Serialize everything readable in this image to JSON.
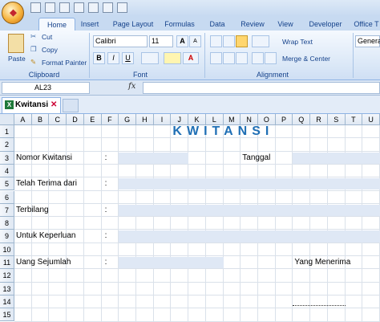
{
  "tabs": [
    "Home",
    "Insert",
    "Page Layout",
    "Formulas",
    "Data",
    "Review",
    "View",
    "Developer",
    "Office T"
  ],
  "clipboard": {
    "paste": "Paste",
    "cut": "Cut",
    "copy": "Copy",
    "format_painter": "Format Painter",
    "label": "Clipboard"
  },
  "font": {
    "name": "Calibri",
    "size": "11",
    "label": "Font",
    "bold": "B",
    "italic": "I",
    "underline": "U",
    "grow": "A",
    "shrink": "A",
    "color": "A"
  },
  "alignment": {
    "wrap_text": "Wrap Text",
    "merge_center": "Merge & Center",
    "label": "Alignment"
  },
  "number": {
    "format": "Genera"
  },
  "formula_bar": {
    "name_box": "AL23",
    "fx": "fx"
  },
  "workbook": {
    "tab_label": "Kwitansi",
    "close": "✕"
  },
  "columns": [
    "A",
    "B",
    "C",
    "D",
    "E",
    "F",
    "G",
    "H",
    "I",
    "J",
    "K",
    "L",
    "M",
    "N",
    "O",
    "P",
    "Q",
    "R",
    "S",
    "T",
    "U"
  ],
  "rows": [
    "1",
    "2",
    "3",
    "4",
    "5",
    "6",
    "7",
    "8",
    "9",
    "10",
    "11",
    "12",
    "13",
    "14",
    "15"
  ],
  "sheet": {
    "title": "KWITANSI",
    "nomor_label": "Nomor Kwitansi",
    "tanggal_label": "Tanggal",
    "terima_label": "Telah Terima dari",
    "terbilang_label": "Terbilang",
    "keperluan_label": "Untuk Keperluan",
    "uang_label": "Uang Sejumlah",
    "penerima_label": "Yang Menerima",
    "colon": ":"
  },
  "colors": {
    "accent": "#1f6fb5",
    "fill": "#dfe8f5",
    "ribbon": "#dbe8f7"
  }
}
